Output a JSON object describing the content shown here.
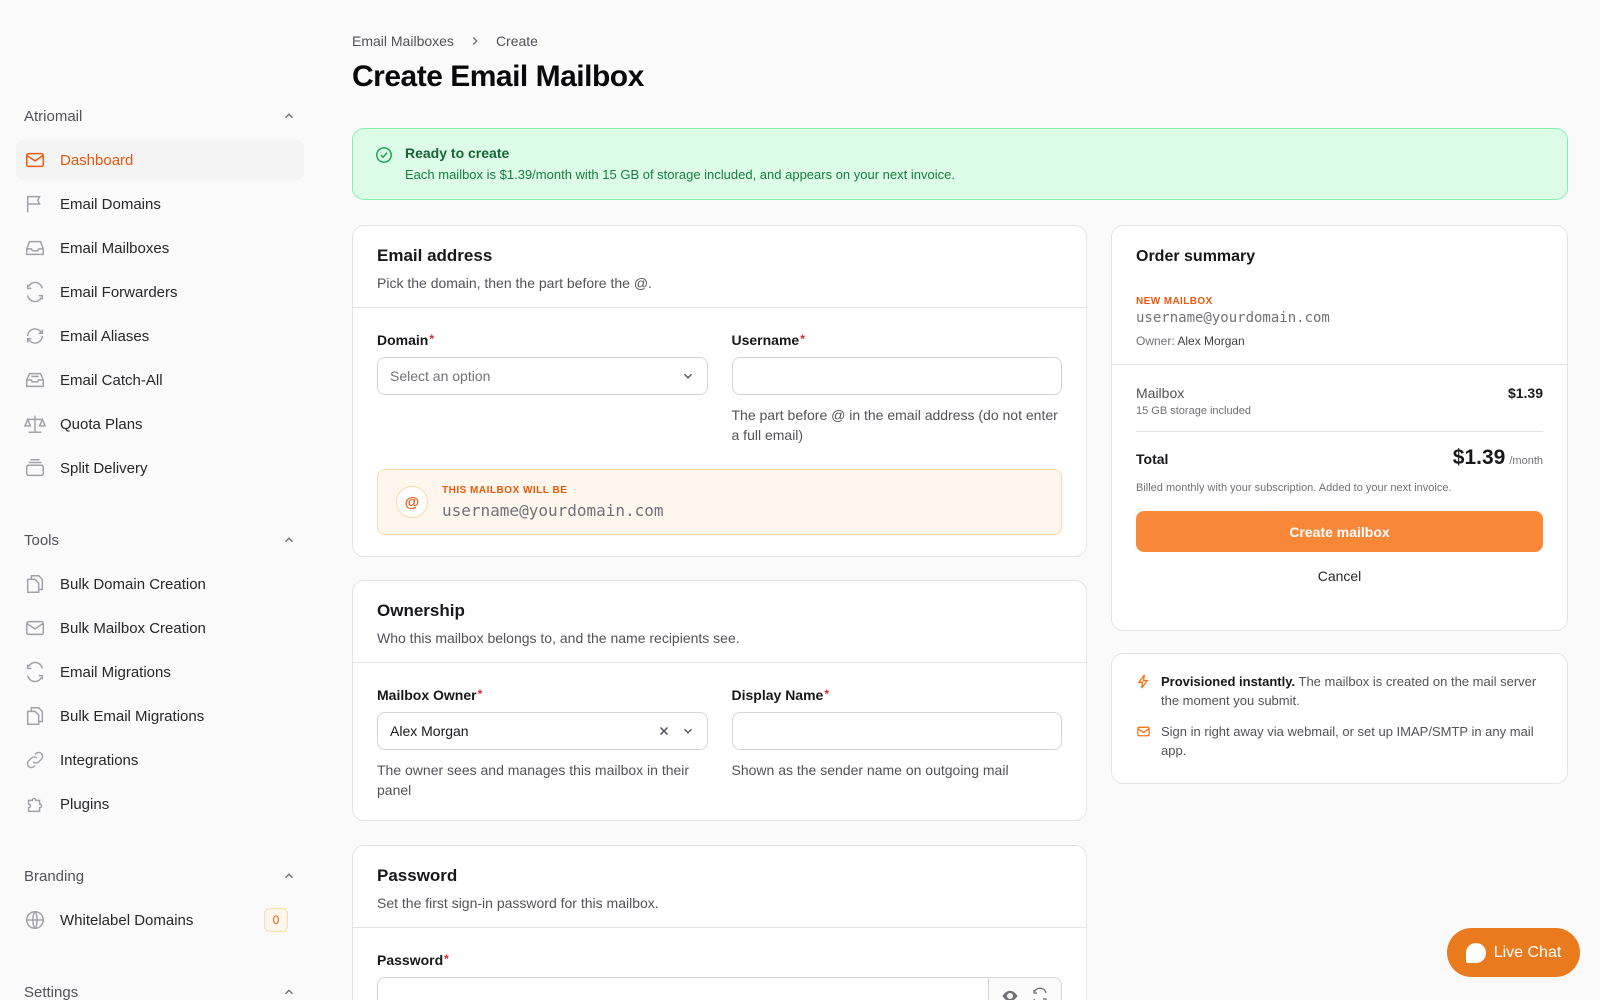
{
  "sidebar": {
    "groups": [
      {
        "title": "Atriomail",
        "items": [
          {
            "label": "Dashboard",
            "icon": "mail-icon"
          },
          {
            "label": "Email Domains",
            "icon": "flag-icon"
          },
          {
            "label": "Email Mailboxes",
            "icon": "inbox-icon"
          },
          {
            "label": "Email Forwarders",
            "icon": "refresh-icon"
          },
          {
            "label": "Email Aliases",
            "icon": "repeat-icon"
          },
          {
            "label": "Email Catch-All",
            "icon": "tray-icon"
          },
          {
            "label": "Quota Plans",
            "icon": "scale-icon"
          },
          {
            "label": "Split Delivery",
            "icon": "stack-icon"
          }
        ]
      },
      {
        "title": "Tools",
        "items": [
          {
            "label": "Bulk Domain Creation",
            "icon": "files-icon"
          },
          {
            "label": "Bulk Mailbox Creation",
            "icon": "mail-icon"
          },
          {
            "label": "Email Migrations",
            "icon": "refresh-icon"
          },
          {
            "label": "Bulk Email Migrations",
            "icon": "files-icon"
          },
          {
            "label": "Integrations",
            "icon": "link-icon"
          },
          {
            "label": "Plugins",
            "icon": "puzzle-icon"
          }
        ]
      },
      {
        "title": "Branding",
        "items": [
          {
            "label": "Whitelabel Domains",
            "icon": "globe-icon",
            "badge": "0"
          }
        ]
      },
      {
        "title": "Settings",
        "items": []
      }
    ]
  },
  "breadcrumb": {
    "parent": "Email Mailboxes",
    "current": "Create"
  },
  "page_title": "Create Email Mailbox",
  "alert": {
    "title": "Ready to create",
    "message": "Each mailbox is $1.39/month with 15 GB of storage included, and appears on your next invoice."
  },
  "email_card": {
    "title": "Email address",
    "subtitle": "Pick the domain, then the part before the @.",
    "domain_label": "Domain",
    "domain_placeholder": "Select an option",
    "username_label": "Username",
    "username_value": "",
    "username_hint": "The part before @ in the email address (do not enter a full email)",
    "preview_caption": "THIS MAILBOX WILL BE",
    "preview_address": "username@yourdomain.com",
    "at_symbol": "@"
  },
  "ownership_card": {
    "title": "Ownership",
    "subtitle": "Who this mailbox belongs to, and the name recipients see.",
    "owner_label": "Mailbox Owner",
    "owner_value": "Alex Morgan",
    "owner_hint": "The owner sees and manages this mailbox in their panel",
    "display_label": "Display Name",
    "display_value": "",
    "display_hint": "Shown as the sender name on outgoing mail"
  },
  "password_card": {
    "title": "Password",
    "subtitle": "Set the first sign-in password for this mailbox.",
    "password_label": "Password"
  },
  "required_mark": "*",
  "summary": {
    "title": "Order summary",
    "new_label": "NEW MAILBOX",
    "address": "username@yourdomain.com",
    "owner_prefix": "Owner:",
    "owner_name": "Alex Morgan",
    "item_name": "Mailbox",
    "item_sub": "15 GB storage included",
    "item_price": "$1.39",
    "total_label": "Total",
    "total_amount": "$1.39",
    "total_period": "/month",
    "billed_note": "Billed monthly with your subscription. Added to your next invoice.",
    "create_label": "Create mailbox",
    "cancel_label": "Cancel"
  },
  "info": {
    "line1_bold": "Provisioned instantly.",
    "line1_rest": " The mailbox is created on the mail server the moment you submit.",
    "line2": "Sign in right away via webmail, or set up IMAP/SMTP in any mail app."
  },
  "livechat_label": "Live Chat",
  "colors": {
    "accent": "#ea580c",
    "success": "#16a34a"
  }
}
